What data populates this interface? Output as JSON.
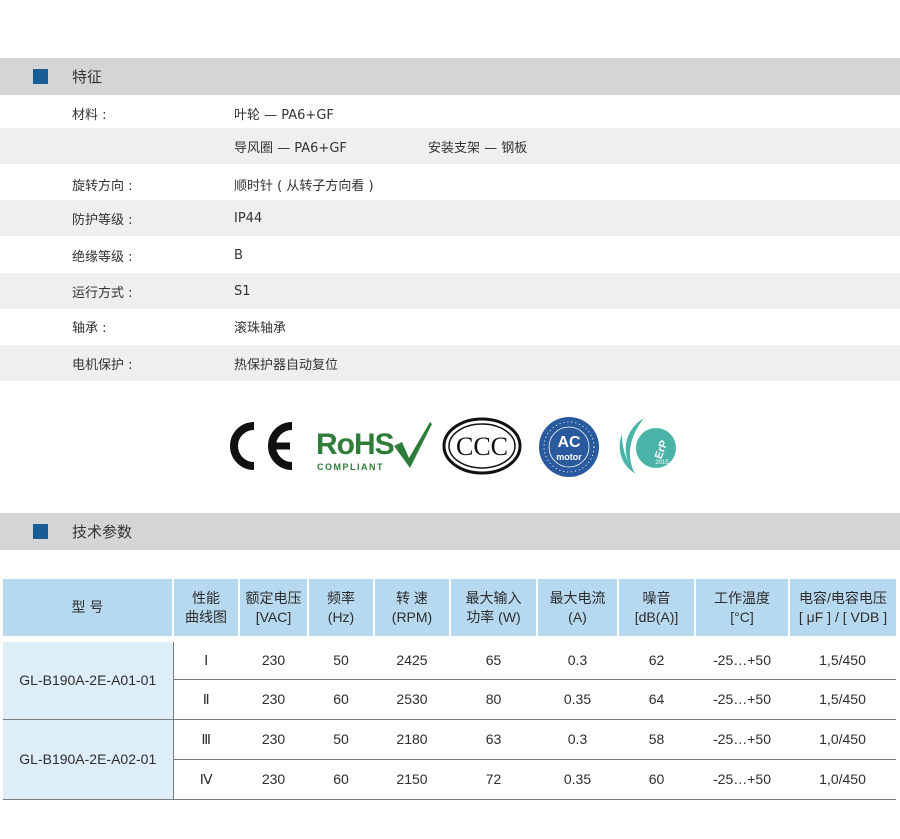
{
  "features": {
    "title": "特征",
    "rows": [
      {
        "label": "材料 :",
        "value": "叶轮 — PA6+GF",
        "value2": ""
      },
      {
        "label": "",
        "value": "导风圈 — PA6+GF",
        "value2": "安装支架 — 钢板"
      },
      {
        "label": "旋转方向 :",
        "value": "顺时针 ( 从转子方向看 )",
        "value2": ""
      },
      {
        "label": "防护等级 :",
        "value": "IP44",
        "value2": ""
      },
      {
        "label": "绝缘等级 :",
        "value": "B",
        "value2": ""
      },
      {
        "label": "运行方式 :",
        "value": "S1",
        "value2": ""
      },
      {
        "label": "轴承 :",
        "value": "滚珠轴承",
        "value2": ""
      },
      {
        "label": "电机保护 :",
        "value": "热保护器自动复位",
        "value2": ""
      }
    ]
  },
  "certifications": {
    "ce": "CE",
    "rohs": "RoHS",
    "rohs_sub": "COMPLIANT",
    "ccc": "CCC",
    "ac_top": "AC",
    "ac_bottom": "motor",
    "erp": "ErP",
    "erp_year": "2015",
    "colors": {
      "rohs_green": "#2e7d3a",
      "ac_blue": "#2a5a9e",
      "erp_teal": "#4ab3a8"
    }
  },
  "specs": {
    "title": "技术参数",
    "headers": [
      {
        "line1": "型 号",
        "line2": ""
      },
      {
        "line1": "性能",
        "line2": "曲线图"
      },
      {
        "line1": "额定电压",
        "line2": "[VAC]"
      },
      {
        "line1": "频率",
        "line2": "(Hz)"
      },
      {
        "line1": "转 速",
        "line2": "(RPM)"
      },
      {
        "line1": "最大输入",
        "line2": "功率 (W)"
      },
      {
        "line1": "最大电流",
        "line2": "(A)"
      },
      {
        "line1": "噪音",
        "line2": "[dB(A)]"
      },
      {
        "line1": "工作温度",
        "line2": "[°C]"
      },
      {
        "line1": "电容/电容电压",
        "line2": "[ μF ] / [ VDB ]"
      }
    ],
    "models": [
      "GL-B190A-2E-A01-01",
      "GL-B190A-2E-A02-01"
    ],
    "rows": [
      {
        "curve": "Ⅰ",
        "voltage": "230",
        "freq": "50",
        "rpm": "2425",
        "power": "65",
        "current": "0.3",
        "noise": "62",
        "temp": "-25…+50",
        "cap": "1,5/450"
      },
      {
        "curve": "Ⅱ",
        "voltage": "230",
        "freq": "60",
        "rpm": "2530",
        "power": "80",
        "current": "0.35",
        "noise": "64",
        "temp": "-25…+50",
        "cap": "1,5/450"
      },
      {
        "curve": "Ⅲ",
        "voltage": "230",
        "freq": "50",
        "rpm": "2180",
        "power": "63",
        "current": "0.3",
        "noise": "58",
        "temp": "-25…+50",
        "cap": "1,0/450"
      },
      {
        "curve": "Ⅳ",
        "voltage": "230",
        "freq": "60",
        "rpm": "2150",
        "power": "72",
        "current": "0.35",
        "noise": "60",
        "temp": "-25…+50",
        "cap": "1,0/450"
      }
    ]
  }
}
